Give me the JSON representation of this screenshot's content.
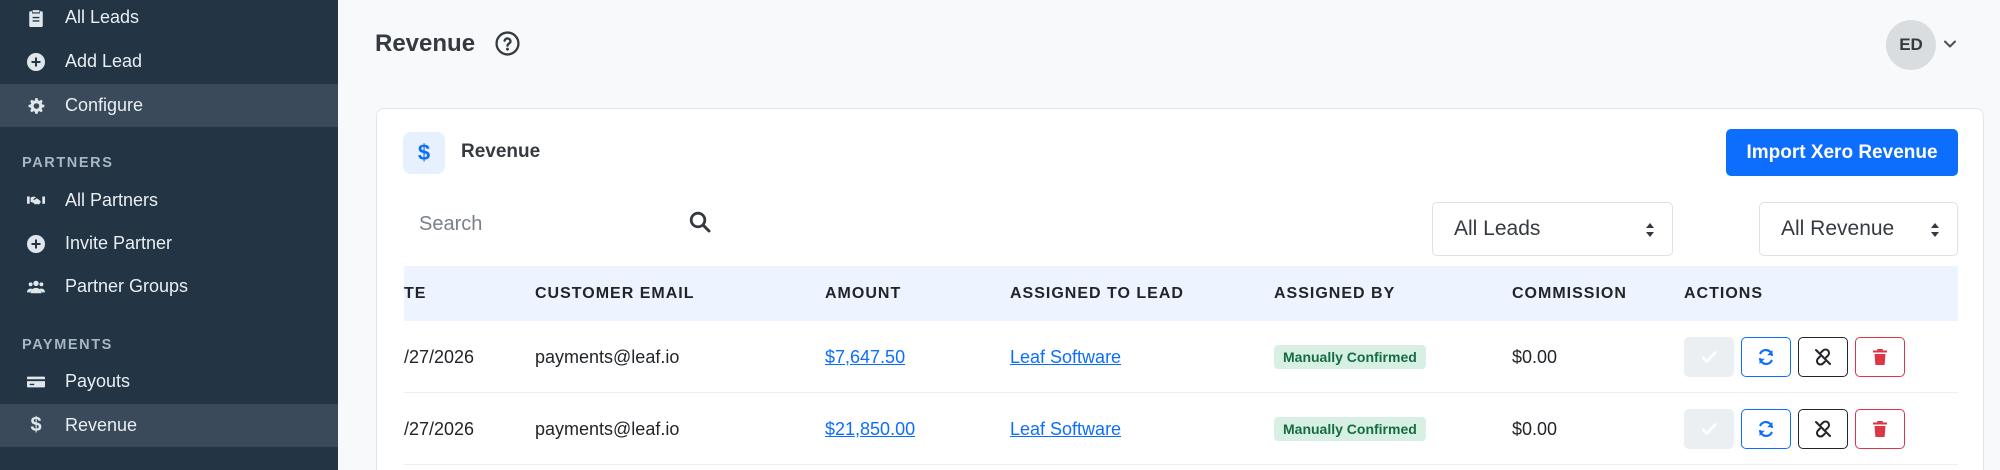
{
  "sidebar": {
    "items_top": [
      {
        "label": "All Leads",
        "icon": "clipboard-icon"
      },
      {
        "label": "Add Lead",
        "icon": "plus-circle-icon"
      },
      {
        "label": "Configure",
        "icon": "gear-icon",
        "active": true
      }
    ],
    "partners_title": "PARTNERS",
    "partners_items": [
      {
        "label": "All Partners",
        "icon": "handshake-icon"
      },
      {
        "label": "Invite Partner",
        "icon": "plus-circle-icon"
      },
      {
        "label": "Partner Groups",
        "icon": "users-icon"
      }
    ],
    "payments_title": "PAYMENTS",
    "payments_items": [
      {
        "label": "Payouts",
        "icon": "credit-card-icon"
      },
      {
        "label": "Revenue",
        "icon": "dollar-icon",
        "active": true
      }
    ]
  },
  "header": {
    "title": "Revenue",
    "avatar_initials": "ED"
  },
  "card": {
    "icon_glyph": "$",
    "title": "Revenue",
    "import_button": "Import Xero Revenue",
    "search_placeholder": "Search",
    "filter_leads": "All Leads",
    "filter_revenue": "All Revenue"
  },
  "table": {
    "columns": {
      "date": "TE",
      "email": "CUSTOMER EMAIL",
      "amount": "AMOUNT",
      "lead": "ASSIGNED TO LEAD",
      "assigned_by": "ASSIGNED BY",
      "commission": "COMMISSION",
      "actions": "ACTIONS"
    },
    "rows": [
      {
        "date": "/27/2026",
        "email": "payments@leaf.io",
        "amount": "$7,647.50",
        "lead": "Leaf Software",
        "assigned_by": "Manually Confirmed",
        "commission": "$0.00"
      },
      {
        "date": "/27/2026",
        "email": "payments@leaf.io",
        "amount": "$21,850.00",
        "lead": "Leaf Software",
        "assigned_by": "Manually Confirmed",
        "commission": "$0.00"
      }
    ]
  },
  "colors": {
    "sidebar_bg": "#233445",
    "sidebar_active": "#3a4a5a",
    "primary": "#0d6efd",
    "danger": "#dc3545",
    "badge_bg": "#d8efe3",
    "badge_text": "#146c43"
  }
}
